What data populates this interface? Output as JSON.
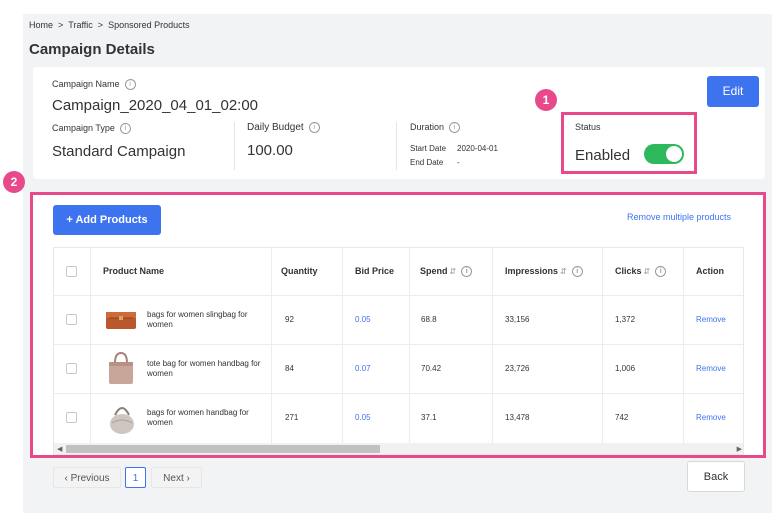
{
  "breadcrumb": [
    "Home",
    ">",
    "Traffic",
    ">",
    "Sponsored Products"
  ],
  "page_title": "Campaign Details",
  "campaign": {
    "name_label": "Campaign Name",
    "name_value": "Campaign_2020_04_01_02:00",
    "type_label": "Campaign Type",
    "type_value": "Standard Campaign",
    "budget_label": "Daily Budget",
    "budget_value": "100.00",
    "duration_label": "Duration",
    "start_label": "Start Date",
    "start_value": "2020-04-01",
    "end_label": "End Date",
    "end_value": "-",
    "status_label": "Status",
    "status_value": "Enabled",
    "status_enabled": true,
    "edit_label": "Edit"
  },
  "badges": [
    "1",
    "2"
  ],
  "products": {
    "add_label": "+ Add Products",
    "remove_multiple_label": "Remove multiple products",
    "columns": [
      "Product Name",
      "Quantity",
      "Bid Price",
      "Spend",
      "Impressions",
      "Clicks",
      "Action"
    ],
    "sort_glyph": "⇵",
    "info_glyph": "i",
    "rows": [
      {
        "name": "bags for women slingbag for women",
        "quantity": "92",
        "bid": "0.05",
        "spend": "68.8",
        "impressions": "33,156",
        "clicks": "1,372",
        "action": "Remove"
      },
      {
        "name": "tote bag for women handbag for women",
        "quantity": "84",
        "bid": "0.07",
        "spend": "70.42",
        "impressions": "23,726",
        "clicks": "1,006",
        "action": "Remove"
      },
      {
        "name": "bags for women handbag for women",
        "quantity": "271",
        "bid": "0.05",
        "spend": "37.1",
        "impressions": "13,478",
        "clicks": "742",
        "action": "Remove"
      }
    ]
  },
  "pagination": {
    "previous": "Previous",
    "page": "1",
    "next": "Next"
  },
  "back_label": "Back",
  "colors": {
    "accent": "#3e73f0",
    "highlight": "#e8498b",
    "toggle_on": "#2eb85c"
  }
}
